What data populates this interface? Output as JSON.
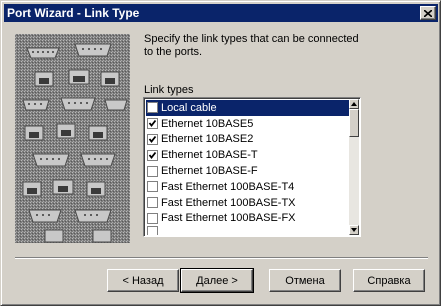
{
  "window": {
    "title": "Port Wizard - Link Type",
    "close_icon": "close-icon"
  },
  "instructions": "Specify the link types that can be connected\nto the ports.",
  "group_label": "Link types",
  "link_types": [
    {
      "label": "Local cable",
      "checked": false,
      "selected": true
    },
    {
      "label": "Ethernet 10BASE5",
      "checked": true,
      "selected": false
    },
    {
      "label": "Ethernet 10BASE2",
      "checked": true,
      "selected": false
    },
    {
      "label": "Ethernet 10BASE-T",
      "checked": true,
      "selected": false
    },
    {
      "label": "Ethernet 10BASE-F",
      "checked": false,
      "selected": false
    },
    {
      "label": "Fast Ethernet 100BASE-T4",
      "checked": false,
      "selected": false
    },
    {
      "label": "Fast Ethernet 100BASE-TX",
      "checked": false,
      "selected": false
    },
    {
      "label": "Fast Ethernet 100BASE-FX",
      "checked": false,
      "selected": false
    }
  ],
  "buttons": {
    "back": "< Назад",
    "next": "Далее >",
    "cancel": "Отмена",
    "help": "Справка"
  },
  "colors": {
    "titlebar": "#0a246a",
    "face": "#d4d0c8",
    "selection": "#0a246a"
  }
}
